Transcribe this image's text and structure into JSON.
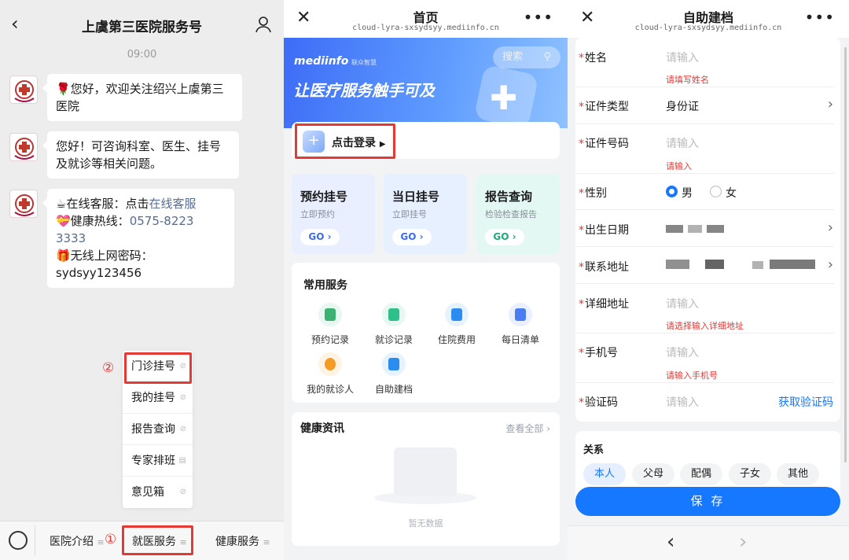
{
  "panel1": {
    "title": "上虞第三医院服务号",
    "time": "09:00",
    "messages": [
      {
        "lines": [
          "🌹您好，欢迎关注绍兴上虞第三",
          "医院"
        ]
      },
      {
        "lines": [
          "您好！可咨询科室、医生、挂号",
          "及就诊等相关问题。"
        ]
      },
      {
        "line1_prefix": "☕在线客服：点击",
        "line1_link": "在线客服",
        "line2_prefix": "💝健康热线：",
        "line2_link": "0575-8223 3333",
        "line3": "🎁无线上网密码：",
        "line4": "sydsyy123456"
      }
    ],
    "menu_items": [
      "门诊挂号",
      "我的挂号",
      "报告查询",
      "专家排班",
      "意见箱"
    ],
    "step_markers": [
      "②",
      "①"
    ],
    "tabs": [
      "医院介绍",
      "就医服务",
      "健康服务"
    ]
  },
  "panel2": {
    "title": "首页",
    "url": "cloud-lyra-sxsydsyy.mediinfo.cn",
    "brand": "mediinfo",
    "brand_sub": "联众智慧",
    "slogan": "让医疗服务触手可及",
    "search": "搜索",
    "login": "点击登录",
    "quick_cards": [
      {
        "title": "预约挂号",
        "sub": "立即预约",
        "go": "GO ›",
        "bg": "#e9efff"
      },
      {
        "title": "当日挂号",
        "sub": "立即挂号",
        "go": "GO ›",
        "bg": "#e6f0ff"
      },
      {
        "title": "报告查询",
        "sub": "检验检查报告",
        "go": "GO ›",
        "bg": "#e4f8f3"
      }
    ],
    "common_title": "常用服务",
    "services": [
      {
        "label": "预约记录",
        "icon": "register-record-icon",
        "color": "#3bb273",
        "bg": "#e8f7ef"
      },
      {
        "label": "就诊记录",
        "icon": "visit-record-icon",
        "color": "#2fbf8a",
        "bg": "#e6f8f1"
      },
      {
        "label": "住院费用",
        "icon": "hospital-fee-icon",
        "color": "#2d8cf0",
        "bg": "#e7f2ff"
      },
      {
        "label": "每日清单",
        "icon": "daily-list-icon",
        "color": "#4a7df0",
        "bg": "#eaf0ff"
      },
      {
        "label": "我的就诊人",
        "icon": "patient-icon",
        "color": "#f59a23",
        "bg": "#fff3e3"
      },
      {
        "label": "自助建档",
        "icon": "self-file-icon",
        "color": "#2d8cf0",
        "bg": "#e7f2ff"
      }
    ],
    "news_title": "健康资讯",
    "see_all": "查看全部 ›",
    "empty": "暂无数据"
  },
  "panel3": {
    "title": "自助建档",
    "url": "cloud-lyra-sxsydsyy.mediinfo.cn",
    "fields": {
      "name": {
        "label": "姓名",
        "placeholder": "请输入",
        "error": "请填写姓名"
      },
      "id_type": {
        "label": "证件类型",
        "value": "身份证"
      },
      "id_no": {
        "label": "证件号码",
        "placeholder": "请输入",
        "error": "请输入"
      },
      "gender": {
        "label": "性别",
        "opt1": "男",
        "opt2": "女"
      },
      "birth": {
        "label": "出生日期"
      },
      "address": {
        "label": "联系地址"
      },
      "detail": {
        "label": "详细地址",
        "placeholder": "请输入",
        "error": "请选择输入详细地址"
      },
      "phone": {
        "label": "手机号",
        "placeholder": "请输入",
        "error": "请输入手机号"
      },
      "code": {
        "label": "验证码",
        "placeholder": "请输入",
        "action": "获取验证码"
      }
    },
    "relation_title": "关系",
    "relations": [
      "本人",
      "父母",
      "配偶",
      "子女",
      "其他"
    ],
    "save": "保 存",
    "nav_back": "‹",
    "nav_forward": "›"
  },
  "colors": {
    "accent": "#1677ff",
    "error": "#e53935",
    "link": "#576b95"
  }
}
